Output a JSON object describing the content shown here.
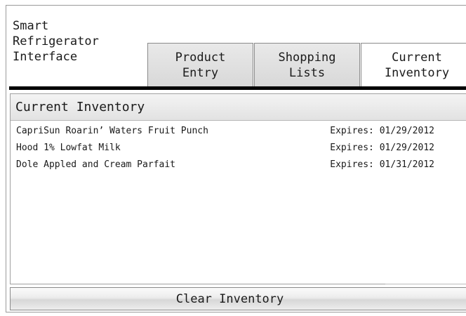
{
  "app": {
    "title": "Smart\nRefrigerator\nInterface"
  },
  "tabs": [
    {
      "label": "Product\nEntry",
      "state": "inactive"
    },
    {
      "label": "Shopping\nLists",
      "state": "inactive"
    },
    {
      "label": "Current\nInventory",
      "state": "active"
    }
  ],
  "inventory": {
    "header": "Current Inventory",
    "expires_label": "Expires:",
    "items": [
      {
        "name": "CapriSun Roarin’ Waters Fruit Punch",
        "expires": "01/29/2012"
      },
      {
        "name": "Hood 1% Lowfat Milk",
        "expires": "01/29/2012"
      },
      {
        "name": "Dole Appled and Cream Parfait",
        "expires": "01/31/2012"
      }
    ]
  },
  "actions": {
    "clear_label": "Clear Inventory"
  }
}
